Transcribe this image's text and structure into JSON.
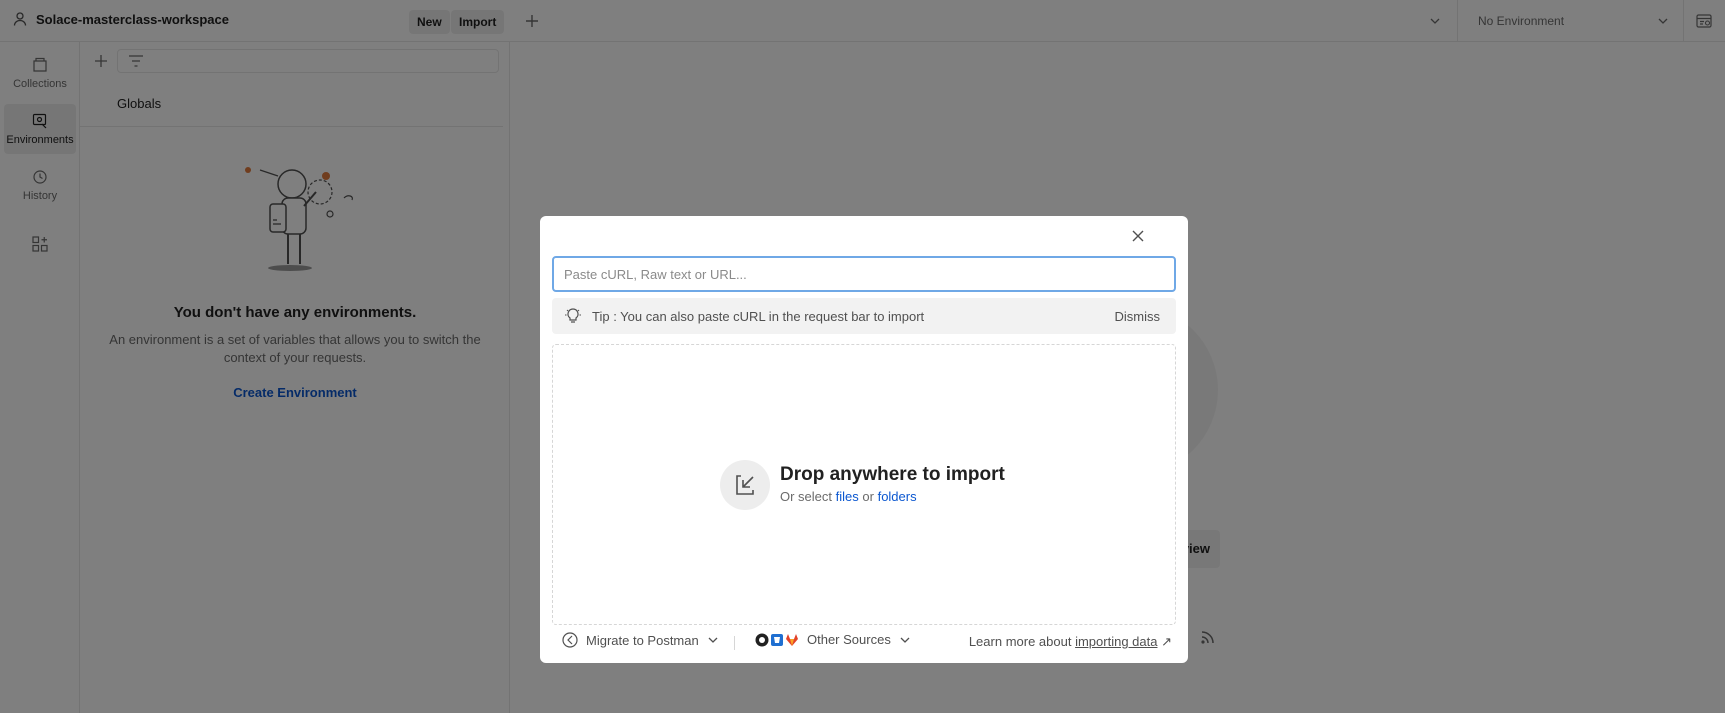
{
  "header": {
    "workspace_name": "Solace-masterclass-workspace",
    "new_label": "New",
    "import_label": "Import",
    "environment_selected": "No Environment"
  },
  "rail": {
    "items": [
      {
        "label": "Collections",
        "icon": "collections-icon"
      },
      {
        "label": "Environments",
        "icon": "environments-icon",
        "active": true
      },
      {
        "label": "History",
        "icon": "history-icon"
      }
    ]
  },
  "sidebar": {
    "globals_label": "Globals",
    "empty_title": "You don't have any environments.",
    "empty_description": "An environment is a set of variables that allows you to switch the context of your requests.",
    "create_label": "Create Environment"
  },
  "background": {
    "button_fragment": "view"
  },
  "modal": {
    "input_placeholder": "Paste cURL, Raw text or URL...",
    "tip_text": "Tip : You can also paste cURL in the request bar to import",
    "dismiss_label": "Dismiss",
    "drop_title": "Drop anywhere to import",
    "drop_sub_prefix": "Or select",
    "files_link": "files",
    "drop_sub_or": "or",
    "folders_link": "folders",
    "migrate_label": "Migrate to Postman",
    "other_sources_label": "Other Sources",
    "learn_prefix": "Learn more about",
    "learn_link": "importing data",
    "learn_arrow": "↗"
  },
  "colors": {
    "link": "#0b57d0",
    "input_focus": "#6fa8e6",
    "overlay": "rgba(0,0,0,0.5)"
  }
}
